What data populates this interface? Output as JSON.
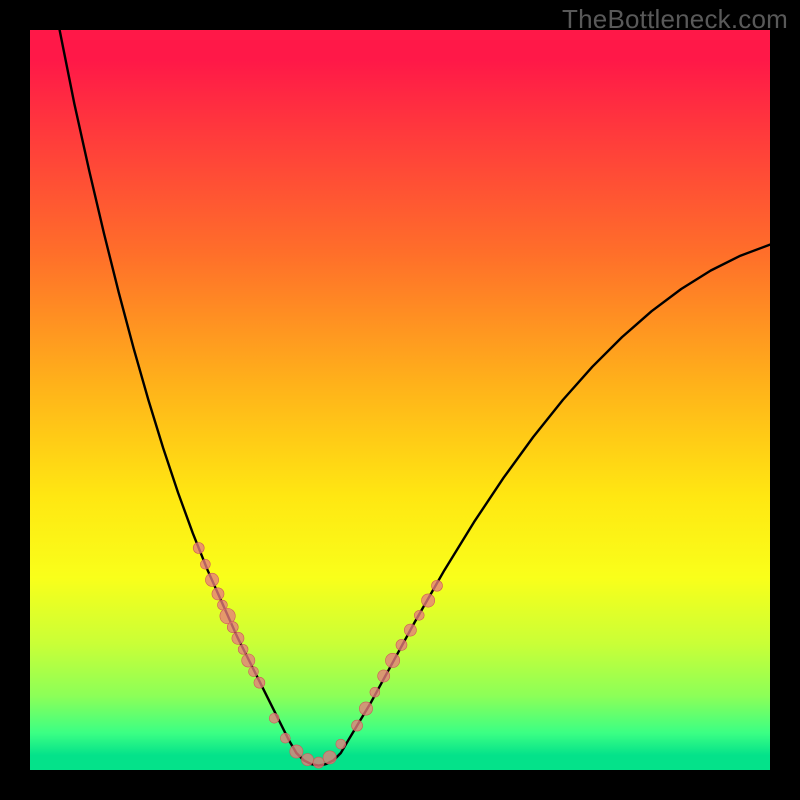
{
  "watermark": "TheBottleneck.com",
  "chart_data": {
    "type": "line",
    "title": "",
    "xlabel": "",
    "ylabel": "",
    "xlim": [
      0,
      100
    ],
    "ylim": [
      0,
      100
    ],
    "series": [
      {
        "name": "left-branch",
        "x": [
          4,
          6,
          8,
          10,
          12,
          14,
          16,
          18,
          20,
          22,
          24,
          26,
          28,
          29.5,
          31,
          33,
          35
        ],
        "y": [
          100,
          90,
          81,
          72.5,
          64.5,
          57,
          50,
          43.5,
          37.5,
          32,
          27,
          22.5,
          18,
          15,
          12,
          8,
          4
        ]
      },
      {
        "name": "valley-floor",
        "x": [
          35,
          36,
          37,
          38,
          39,
          40,
          41,
          42,
          43
        ],
        "y": [
          4,
          2.3,
          1.3,
          0.8,
          0.6,
          0.8,
          1.3,
          2.3,
          4
        ]
      },
      {
        "name": "right-branch",
        "x": [
          43,
          46,
          49,
          52,
          56,
          60,
          64,
          68,
          72,
          76,
          80,
          84,
          88,
          92,
          96,
          100
        ],
        "y": [
          4,
          9,
          14.5,
          20,
          27,
          33.5,
          39.5,
          45,
          50,
          54.5,
          58.5,
          62,
          65,
          67.5,
          69.5,
          71
        ]
      }
    ],
    "markers": [
      {
        "name": "left-cluster",
        "x": [
          22.8,
          23.7,
          24.6,
          25.4,
          26.0,
          26.7,
          27.4,
          28.1,
          28.8,
          29.5,
          30.2,
          31.0
        ],
        "y": [
          30.0,
          27.8,
          25.7,
          23.8,
          22.3,
          20.8,
          19.3,
          17.8,
          16.3,
          14.8,
          13.3,
          11.8
        ],
        "r": [
          10,
          9,
          12,
          11,
          9,
          14,
          10,
          11,
          9,
          12,
          9,
          10
        ]
      },
      {
        "name": "floor-cluster",
        "x": [
          33.0,
          34.5,
          36.0,
          37.5,
          39.0,
          40.5,
          42.0
        ],
        "y": [
          7.0,
          4.3,
          2.5,
          1.4,
          1.0,
          1.7,
          3.5
        ],
        "r": [
          9,
          9,
          12,
          11,
          10,
          12,
          9
        ]
      },
      {
        "name": "right-cluster",
        "x": [
          44.2,
          45.4,
          46.6,
          47.8,
          49.0,
          50.2,
          51.4,
          52.6,
          53.8,
          55.0
        ],
        "y": [
          6.0,
          8.3,
          10.5,
          12.7,
          14.8,
          16.9,
          18.9,
          20.9,
          22.9,
          24.9
        ],
        "r": [
          10,
          12,
          9,
          11,
          13,
          10,
          11,
          9,
          12,
          10
        ]
      }
    ],
    "colors": {
      "curve": "#000000",
      "marker_fill": "#e77c7c",
      "marker_stroke": "#cf5a5a"
    }
  }
}
